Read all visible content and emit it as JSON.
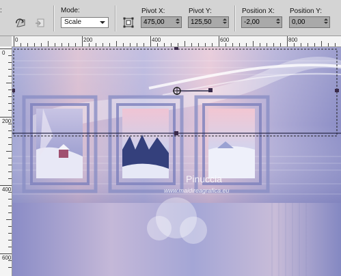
{
  "toolbar": {
    "mode_label": "Mode:",
    "mode_value": "Scale",
    "pivot_x_label": "Pivot X:",
    "pivot_x_value": "475,00",
    "pivot_y_label": "Pivot Y:",
    "pivot_y_value": "125,50",
    "position_x_label": "Position X:",
    "position_x_value": "-2,00",
    "position_y_label": "Position Y:",
    "position_y_value": "0,00",
    "left_edge_label": ":"
  },
  "ruler": {
    "horizontal_ticks": [
      "0",
      "200",
      "400",
      "600",
      "800"
    ],
    "vertical_ticks": [
      "0",
      "200",
      "400",
      "600"
    ]
  },
  "canvas": {
    "watermark_title": "Pinuccia",
    "watermark_url": "www.maidireagrafica.eu"
  },
  "colors": {
    "toolbar_bg": "#d4d4d4",
    "lavender": "#b4b0d8",
    "pink": "#e8c4d4",
    "blue_violet": "#8a8ec8"
  }
}
